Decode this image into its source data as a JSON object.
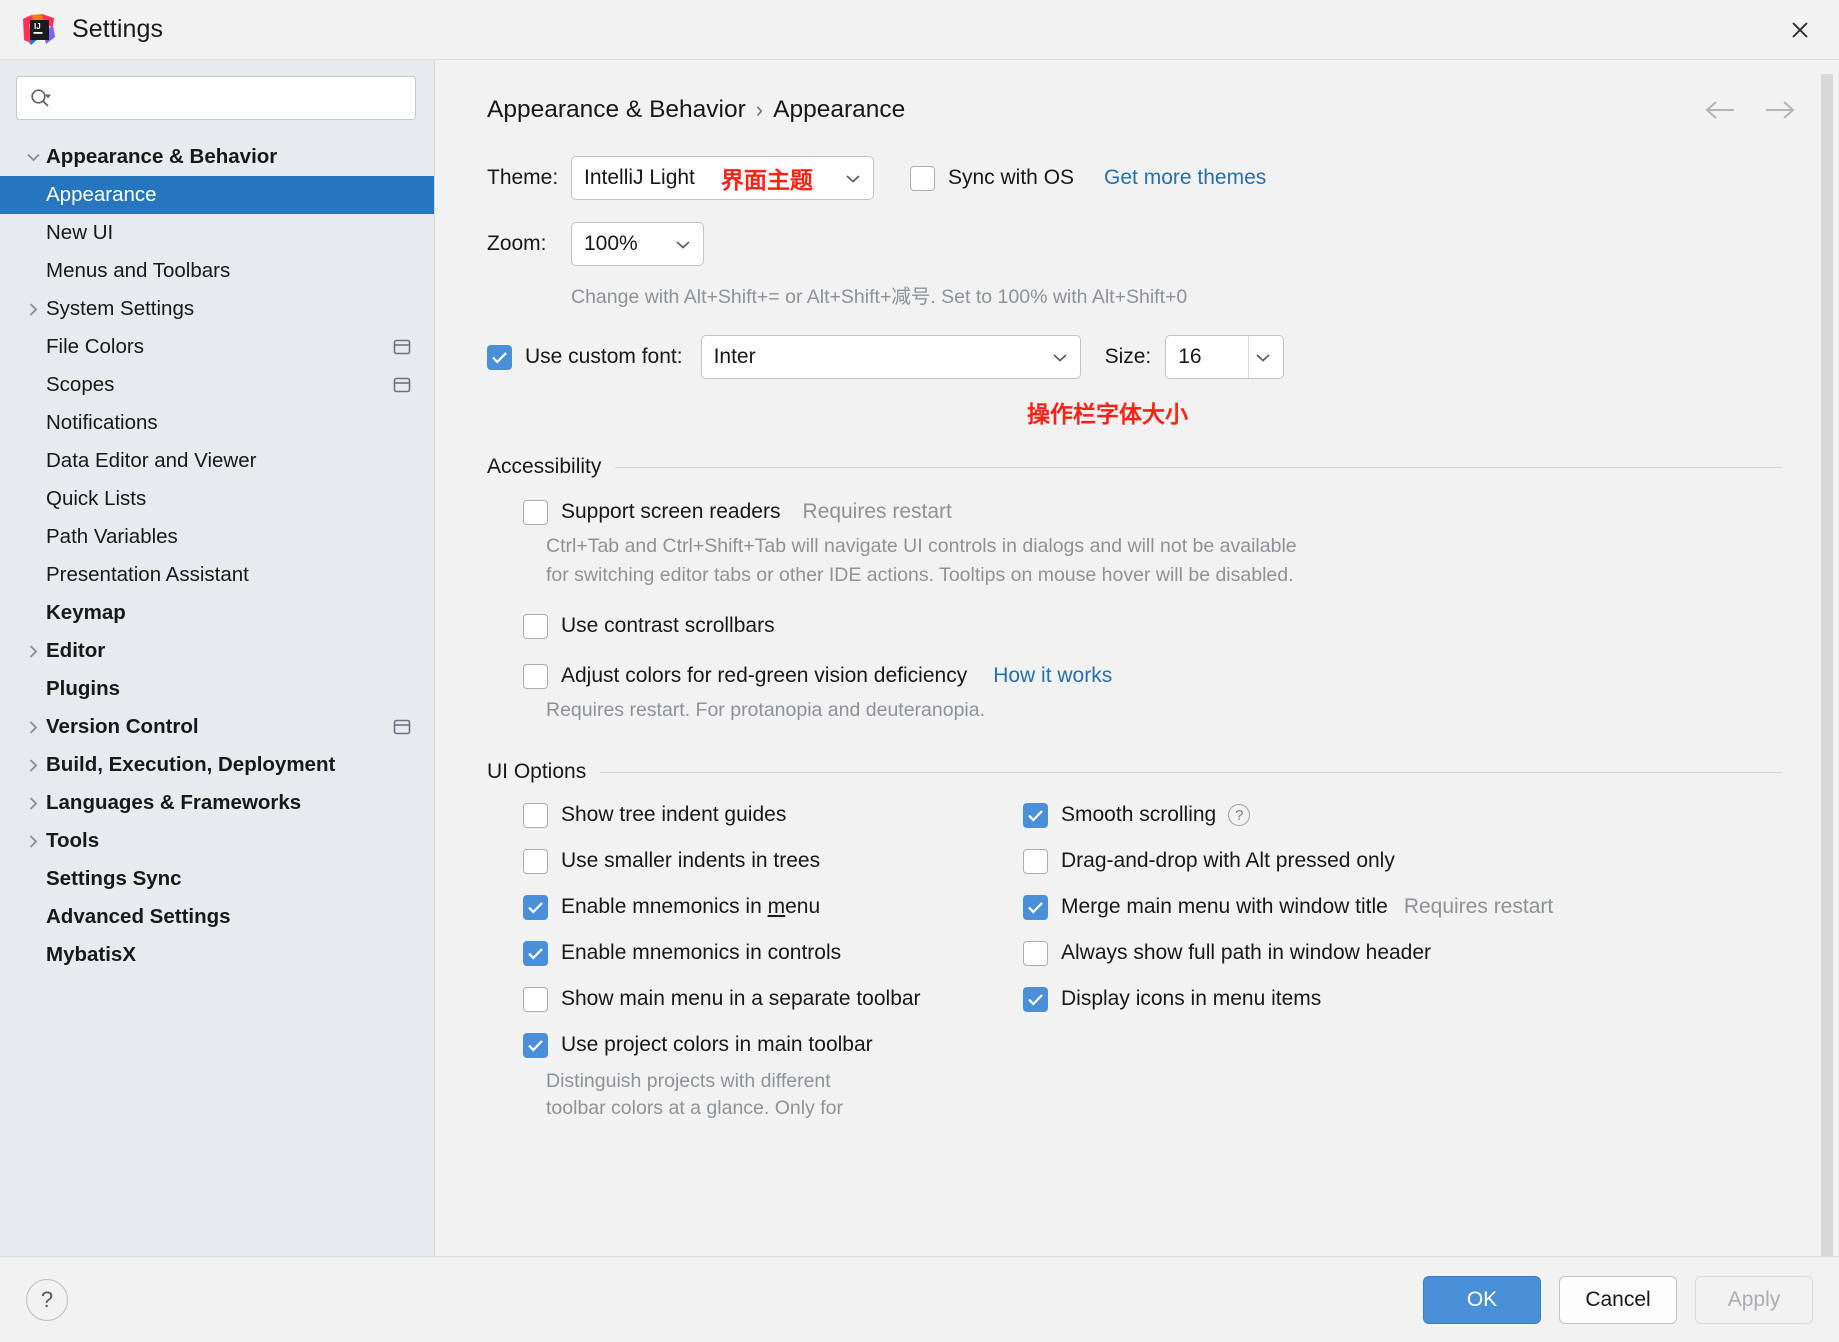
{
  "window": {
    "title": "Settings",
    "logo_icon": "intellij-idea-logo",
    "close_icon": "close-icon"
  },
  "sidebar": {
    "search": {
      "placeholder": "",
      "value": "",
      "icon": "search-icon"
    },
    "items": [
      {
        "label": "Appearance & Behavior",
        "level": 0,
        "expanded": true,
        "chevron": "chevron-down-icon",
        "selected": false,
        "bold": true,
        "project_icon": false
      },
      {
        "label": "Appearance",
        "level": 1,
        "expanded": null,
        "chevron": "",
        "selected": true,
        "bold": false,
        "project_icon": false
      },
      {
        "label": "New UI",
        "level": 1,
        "expanded": null,
        "chevron": "",
        "selected": false,
        "bold": false,
        "project_icon": false
      },
      {
        "label": "Menus and Toolbars",
        "level": 1,
        "expanded": null,
        "chevron": "",
        "selected": false,
        "bold": false,
        "project_icon": false
      },
      {
        "label": "System Settings",
        "level": 1,
        "expanded": false,
        "chevron": "chevron-right-icon",
        "selected": false,
        "bold": false,
        "project_icon": false
      },
      {
        "label": "File Colors",
        "level": 1,
        "expanded": null,
        "chevron": "",
        "selected": false,
        "bold": false,
        "project_icon": true
      },
      {
        "label": "Scopes",
        "level": 1,
        "expanded": null,
        "chevron": "",
        "selected": false,
        "bold": false,
        "project_icon": true
      },
      {
        "label": "Notifications",
        "level": 1,
        "expanded": null,
        "chevron": "",
        "selected": false,
        "bold": false,
        "project_icon": false
      },
      {
        "label": "Data Editor and Viewer",
        "level": 1,
        "expanded": null,
        "chevron": "",
        "selected": false,
        "bold": false,
        "project_icon": false
      },
      {
        "label": "Quick Lists",
        "level": 1,
        "expanded": null,
        "chevron": "",
        "selected": false,
        "bold": false,
        "project_icon": false
      },
      {
        "label": "Path Variables",
        "level": 1,
        "expanded": null,
        "chevron": "",
        "selected": false,
        "bold": false,
        "project_icon": false
      },
      {
        "label": "Presentation Assistant",
        "level": 1,
        "expanded": null,
        "chevron": "",
        "selected": false,
        "bold": false,
        "project_icon": false
      },
      {
        "label": "Keymap",
        "level": 0,
        "expanded": null,
        "chevron": "",
        "selected": false,
        "bold": true,
        "project_icon": false
      },
      {
        "label": "Editor",
        "level": 0,
        "expanded": false,
        "chevron": "chevron-right-icon",
        "selected": false,
        "bold": true,
        "project_icon": false
      },
      {
        "label": "Plugins",
        "level": 0,
        "expanded": null,
        "chevron": "",
        "selected": false,
        "bold": true,
        "project_icon": false
      },
      {
        "label": "Version Control",
        "level": 0,
        "expanded": false,
        "chevron": "chevron-right-icon",
        "selected": false,
        "bold": true,
        "project_icon": true
      },
      {
        "label": "Build, Execution, Deployment",
        "level": 0,
        "expanded": false,
        "chevron": "chevron-right-icon",
        "selected": false,
        "bold": true,
        "project_icon": false
      },
      {
        "label": "Languages & Frameworks",
        "level": 0,
        "expanded": false,
        "chevron": "chevron-right-icon",
        "selected": false,
        "bold": true,
        "project_icon": false
      },
      {
        "label": "Tools",
        "level": 0,
        "expanded": false,
        "chevron": "chevron-right-icon",
        "selected": false,
        "bold": true,
        "project_icon": false
      },
      {
        "label": "Settings Sync",
        "level": 0,
        "expanded": null,
        "chevron": "",
        "selected": false,
        "bold": true,
        "project_icon": false
      },
      {
        "label": "Advanced Settings",
        "level": 0,
        "expanded": null,
        "chevron": "",
        "selected": false,
        "bold": true,
        "project_icon": false
      },
      {
        "label": "MybatisX",
        "level": 0,
        "expanded": null,
        "chevron": "",
        "selected": false,
        "bold": true,
        "project_icon": false
      }
    ]
  },
  "main": {
    "breadcrumb": {
      "parent": "Appearance & Behavior",
      "separator": "›",
      "current": "Appearance"
    },
    "nav": {
      "back_icon": "arrow-left-icon",
      "forward_icon": "arrow-right-icon"
    },
    "theme": {
      "label": "Theme:",
      "value": "IntelliJ Light",
      "annotation_cjk": "界面主题",
      "annotation_color": "#ff2116",
      "sync_with_os_label": "Sync with OS",
      "sync_with_os_checked": false,
      "get_more_themes_label": "Get more themes",
      "link_color": "#2470b3"
    },
    "zoom": {
      "label": "Zoom:",
      "value": "100%",
      "hint": "Change with Alt+Shift+= or Alt+Shift+减号. Set to 100% with Alt+Shift+0"
    },
    "custom_font": {
      "label": "Use custom font:",
      "checked": true,
      "font_value": "Inter",
      "size_label": "Size:",
      "size_value": "16",
      "annotation_cjk": "操作栏字体大小",
      "annotation_color": "#ff2116"
    },
    "accessibility": {
      "title": "Accessibility",
      "screen_readers": {
        "label": "Support screen readers",
        "checked": false,
        "badge": "Requires restart",
        "description_line1": "Ctrl+Tab and Ctrl+Shift+Tab will navigate UI controls in dialogs and will not be available",
        "description_line2": "for switching editor tabs or other IDE actions. Tooltips on mouse hover will be disabled."
      },
      "contrast_scrollbars": {
        "label": "Use contrast scrollbars",
        "checked": false
      },
      "red_green": {
        "label": "Adjust colors for red-green vision deficiency",
        "checked": false,
        "link": "How it works",
        "description": "Requires restart. For protanopia and deuteranopia."
      }
    },
    "ui_options": {
      "title": "UI Options",
      "left": [
        {
          "label": "Show tree indent guides",
          "checked": false
        },
        {
          "label": "Use smaller indents in trees",
          "checked": false
        },
        {
          "label": "Enable mnemonics in menu",
          "checked": true,
          "mnemonic": "m"
        },
        {
          "label": "Enable mnemonics in controls",
          "checked": true
        },
        {
          "label": "Show main menu in a separate toolbar",
          "checked": false
        },
        {
          "label": "Use project colors in main toolbar",
          "checked": true
        }
      ],
      "left_description_line1": "Distinguish projects with different",
      "left_description_line2": "toolbar colors at a glance. Only for",
      "right": [
        {
          "label": "Smooth scrolling",
          "checked": true,
          "help": "?"
        },
        {
          "label": "Drag-and-drop with Alt pressed only",
          "checked": false
        },
        {
          "label": "Merge main menu with window title",
          "checked": true,
          "badge": "Requires restart"
        },
        {
          "label": "Always show full path in window header",
          "checked": false
        },
        {
          "label": "Display icons in menu items",
          "checked": true
        }
      ]
    }
  },
  "footer": {
    "help_label": "?",
    "ok_label": "OK",
    "cancel_label": "Cancel",
    "apply_label": "Apply",
    "apply_enabled": false,
    "primary_color": "#4a90d9"
  }
}
